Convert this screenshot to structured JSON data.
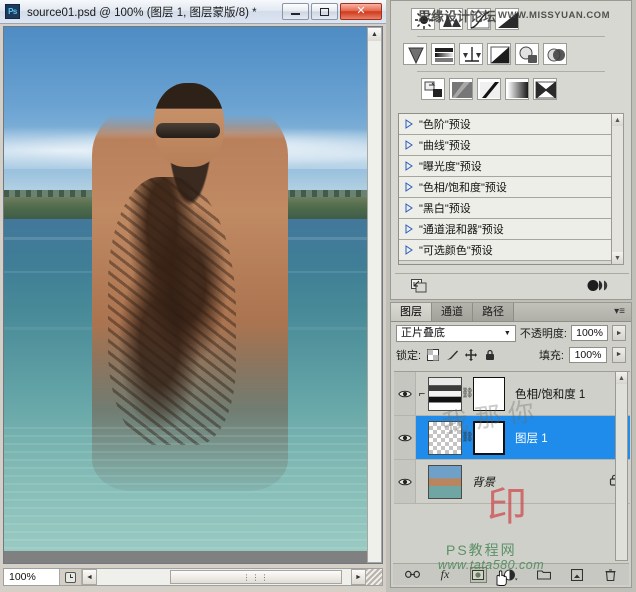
{
  "document_window": {
    "title": "source01.psd @ 100% (图层 1, 图层蒙版/8) *",
    "app_icon": "Ps",
    "controls": {
      "minimize": "minimize-icon",
      "maximize": "maximize-icon",
      "close": "✕"
    },
    "status": {
      "zoom": "100%",
      "status_icon": "proof-icon",
      "scroll_thumb": "⋮⋮⋮"
    },
    "scroll": {
      "up": "▲",
      "down": "▼",
      "left": "◄",
      "right": "►"
    }
  },
  "adjustments_panel": {
    "watermark_cn": "思缘设计论坛",
    "watermark_site": "WWW.MISSYUAN.COM",
    "icons_row1": [
      "brightness-contrast-icon",
      "levels-icon",
      "curves-icon",
      "exposure-icon"
    ],
    "icons_row2": [
      "vibrance-icon",
      "hue-saturation-icon",
      "color-balance-icon",
      "black-white-icon",
      "photo-filter-icon",
      "channel-mixer-icon"
    ],
    "icons_row3": [
      "invert-icon",
      "posterize-icon",
      "threshold-icon",
      "gradient-map-icon",
      "selective-color-icon"
    ],
    "presets": [
      "\"色阶\"预设",
      "\"曲线\"预设",
      "\"曝光度\"预设",
      "\"色相/饱和度\"预设",
      "\"黑白\"预设",
      "\"通道混和器\"预设",
      "\"可选颜色\"预设"
    ],
    "footer": {
      "expand_icon": "expand-view-icon",
      "clip_icon": "clip-to-layer-icon"
    }
  },
  "layers_panel": {
    "tabs": [
      {
        "label": "图层",
        "active": true
      },
      {
        "label": "通道",
        "active": false
      },
      {
        "label": "路径",
        "active": false
      }
    ],
    "menu_icon": "panel-menu-icon",
    "blend_mode": "正片叠底",
    "opacity_label": "不透明度:",
    "opacity_value": "100%",
    "lock_label": "锁定:",
    "lock_icons": [
      "lock-transparent-icon",
      "lock-image-icon",
      "lock-position-icon",
      "lock-all-icon"
    ],
    "fill_label": "填充:",
    "fill_value": "100%",
    "layers": [
      {
        "name": "色相/饱和度 1",
        "visible": true,
        "selected": false,
        "clipped": true,
        "thumb": "gradient-map-thumb",
        "mask": "white-mask",
        "locked": false,
        "italic": false
      },
      {
        "name": "图层 1",
        "visible": true,
        "selected": true,
        "clipped": false,
        "thumb": "transparent-thumb",
        "mask": "white-mask",
        "locked": false,
        "italic": false
      },
      {
        "name": "背景",
        "visible": true,
        "selected": false,
        "clipped": false,
        "thumb": "photo-thumb",
        "mask": null,
        "locked": true,
        "italic": true
      }
    ],
    "footer_buttons": [
      {
        "name": "link-layers-button",
        "glyph": "🔗",
        "pressed": false
      },
      {
        "name": "layer-style-button",
        "glyph": "fx",
        "pressed": false
      },
      {
        "name": "add-layer-mask-button",
        "glyph": "mask",
        "pressed": true
      },
      {
        "name": "new-adjustment-layer-button",
        "glyph": "half-circle",
        "pressed": false
      },
      {
        "name": "new-group-button",
        "glyph": "folder",
        "pressed": false
      },
      {
        "name": "new-layer-button",
        "glyph": "page",
        "pressed": false
      },
      {
        "name": "delete-layer-button",
        "glyph": "trash",
        "pressed": false
      }
    ]
  },
  "watermarks": {
    "chinese_overlay": "我 那 你",
    "seal": "印",
    "brand": "PS教程网",
    "url": "www.tata580.com"
  },
  "colors": {
    "selection_blue": "#1f8bea",
    "panel_bg": "#d0d0ca",
    "close_red": "#cf3a1c",
    "watermark_green": "#4f8b5e",
    "seal_red": "#cc4b4b"
  },
  "cursor": {
    "type": "hand-pointer-cursor"
  }
}
